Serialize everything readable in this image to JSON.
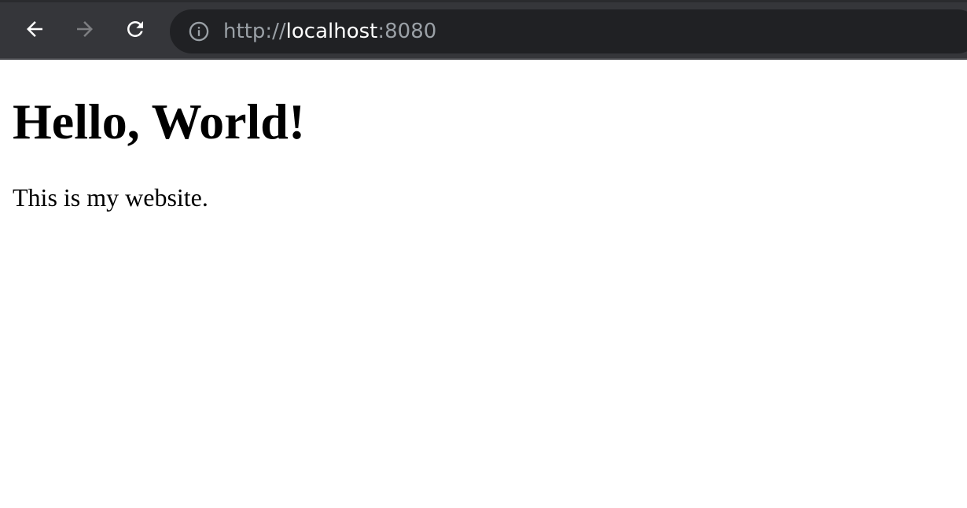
{
  "browser": {
    "url": {
      "scheme": "http://",
      "host": "localhost",
      "port": ":8080"
    },
    "icons": {
      "back": "arrow-left-icon",
      "forward": "arrow-right-icon",
      "reload": "reload-icon",
      "info": "info-icon"
    },
    "colors": {
      "toolbar": "#35363a",
      "omnibox": "#202124",
      "icon_active": "#ffffff",
      "icon_disabled": "#7d7e81",
      "url_dim": "#9aa0a6"
    }
  },
  "page": {
    "heading": "Hello, World!",
    "paragraph": "This is my website."
  }
}
